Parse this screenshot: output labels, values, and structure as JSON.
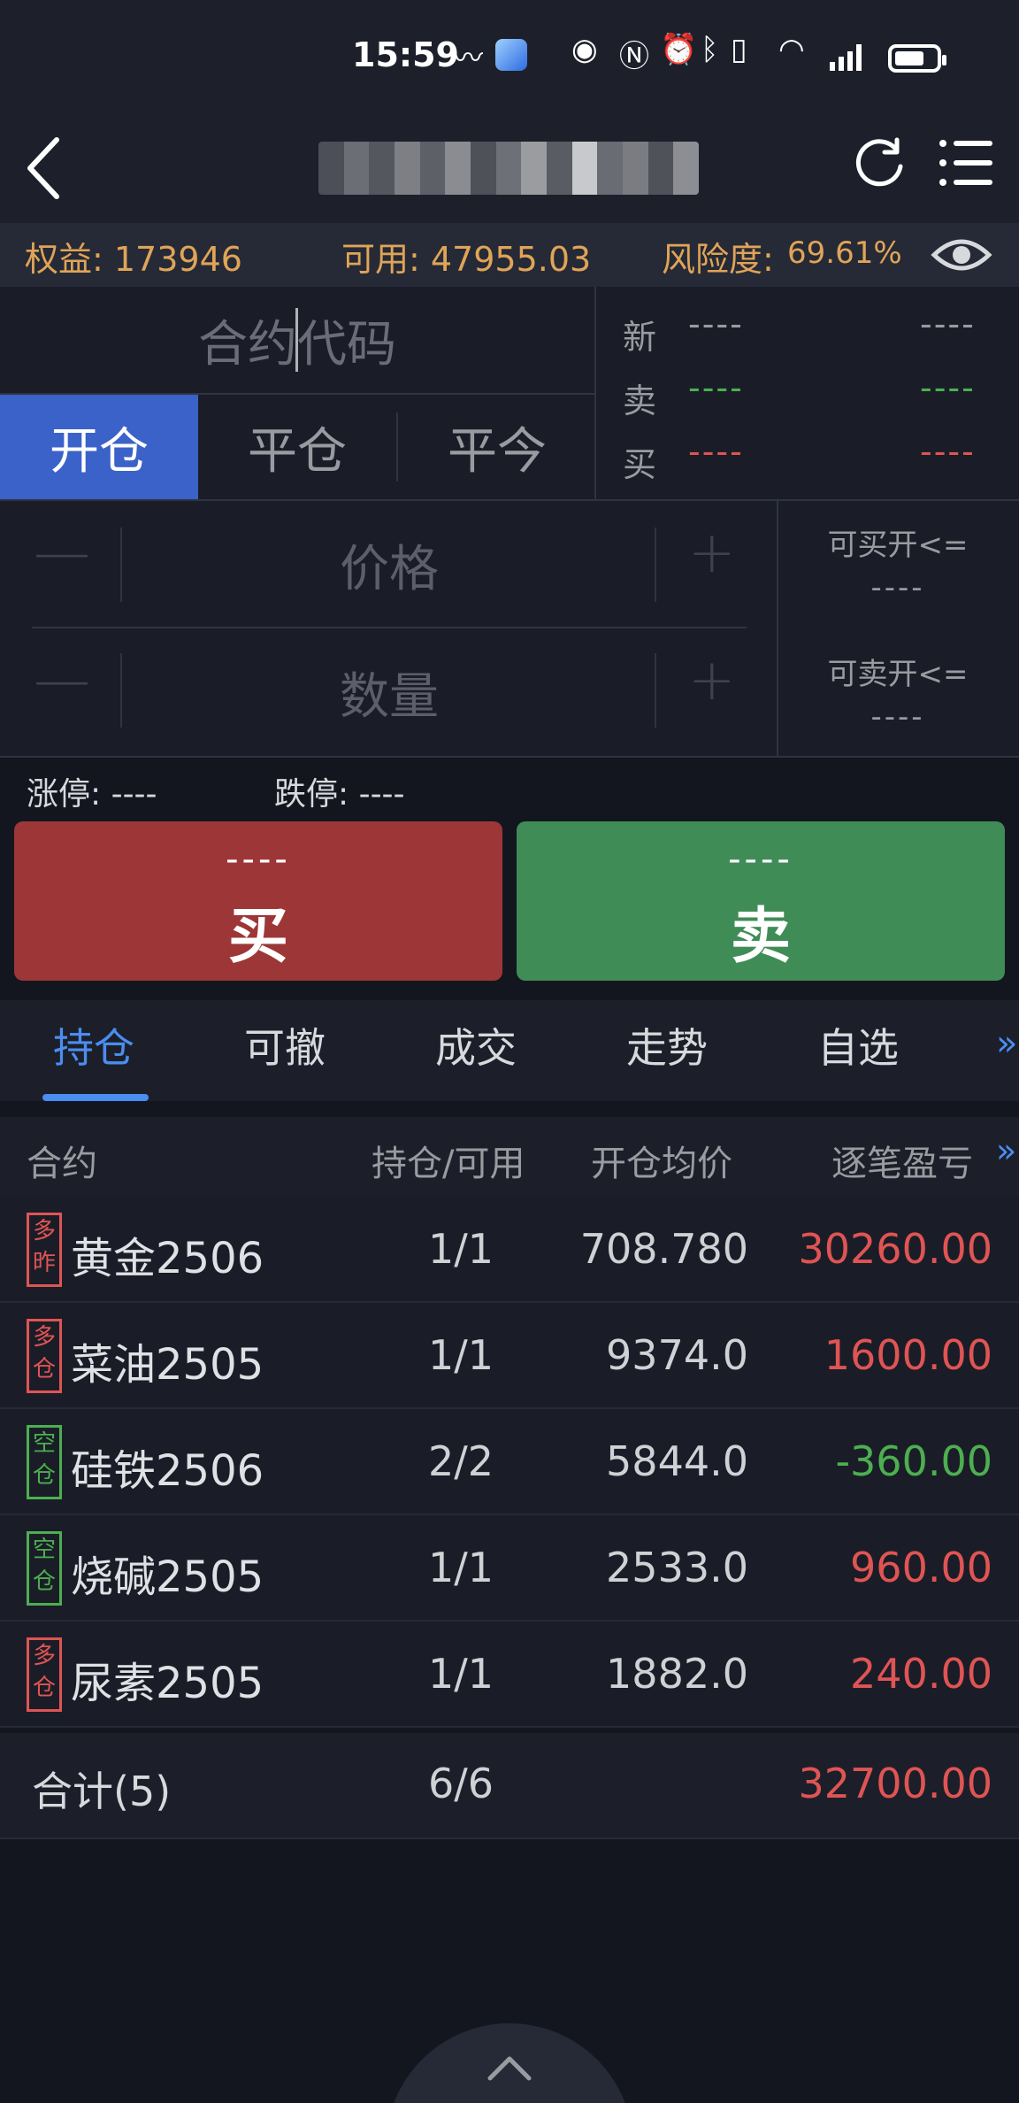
{
  "status_bar": {
    "time": "15:59"
  },
  "account": {
    "equity_label": "权益: 173946",
    "available_label": "可用: 47955.03",
    "risk_label": "风险度:",
    "risk_value": "69.61%"
  },
  "order": {
    "contract_placeholder": "合约代码",
    "tabs": [
      "开仓",
      "平仓",
      "平今"
    ],
    "quote_labels": [
      "新",
      "卖",
      "买"
    ],
    "quote_value": "----",
    "price_placeholder": "价格",
    "qty_placeholder": "数量",
    "minus": "—",
    "plus": "+",
    "can_buy_label": "可买开<=",
    "can_buy_value": "----",
    "can_sell_label": "可卖开<=",
    "can_sell_value": "----",
    "limit_up": "涨停: ----",
    "limit_down": "跌停: ----",
    "buy_price": "----",
    "buy_label": "买",
    "sell_price": "----",
    "sell_label": "卖"
  },
  "lower_tabs": [
    "持仓",
    "可撤",
    "成交",
    "走势",
    "自选"
  ],
  "positions": {
    "headers": [
      "合约",
      "持仓/可用",
      "开仓均价",
      "逐笔盈亏"
    ],
    "more_icon": "»",
    "rows": [
      {
        "badge_top": "多",
        "badge_bottom": "昨",
        "name": "黄金2506",
        "qty": "1/1",
        "price": "708.780",
        "pnl": "30260.00",
        "dir": "long"
      },
      {
        "badge_top": "多",
        "badge_bottom": "仓",
        "name": "菜油2505",
        "qty": "1/1",
        "price": "9374.0",
        "pnl": "1600.00",
        "dir": "long"
      },
      {
        "badge_top": "空",
        "badge_bottom": "仓",
        "name": "硅铁2506",
        "qty": "2/2",
        "price": "5844.0",
        "pnl": "-360.00",
        "dir": "short"
      },
      {
        "badge_top": "空",
        "badge_bottom": "仓",
        "name": "烧碱2505",
        "qty": "1/1",
        "price": "2533.0",
        "pnl": "960.00",
        "dir": "short"
      },
      {
        "badge_top": "多",
        "badge_bottom": "仓",
        "name": "尿素2505",
        "qty": "1/1",
        "price": "1882.0",
        "pnl": "240.00",
        "dir": "long"
      }
    ],
    "total": {
      "label": "合计(5)",
      "qty": "6/6",
      "pnl": "32700.00"
    }
  },
  "colors": {
    "accent_orange": "#e0a458",
    "buy_red": "#9d3737",
    "sell_green": "#3f8c57",
    "profit_red": "#e05454",
    "loss_green": "#4caf50",
    "tab_active_blue": "#3b62c8",
    "link_blue": "#4b8df0"
  },
  "icons": [
    "back-icon",
    "refresh-icon",
    "menu-icon",
    "eye-icon",
    "chevron-up-icon"
  ]
}
